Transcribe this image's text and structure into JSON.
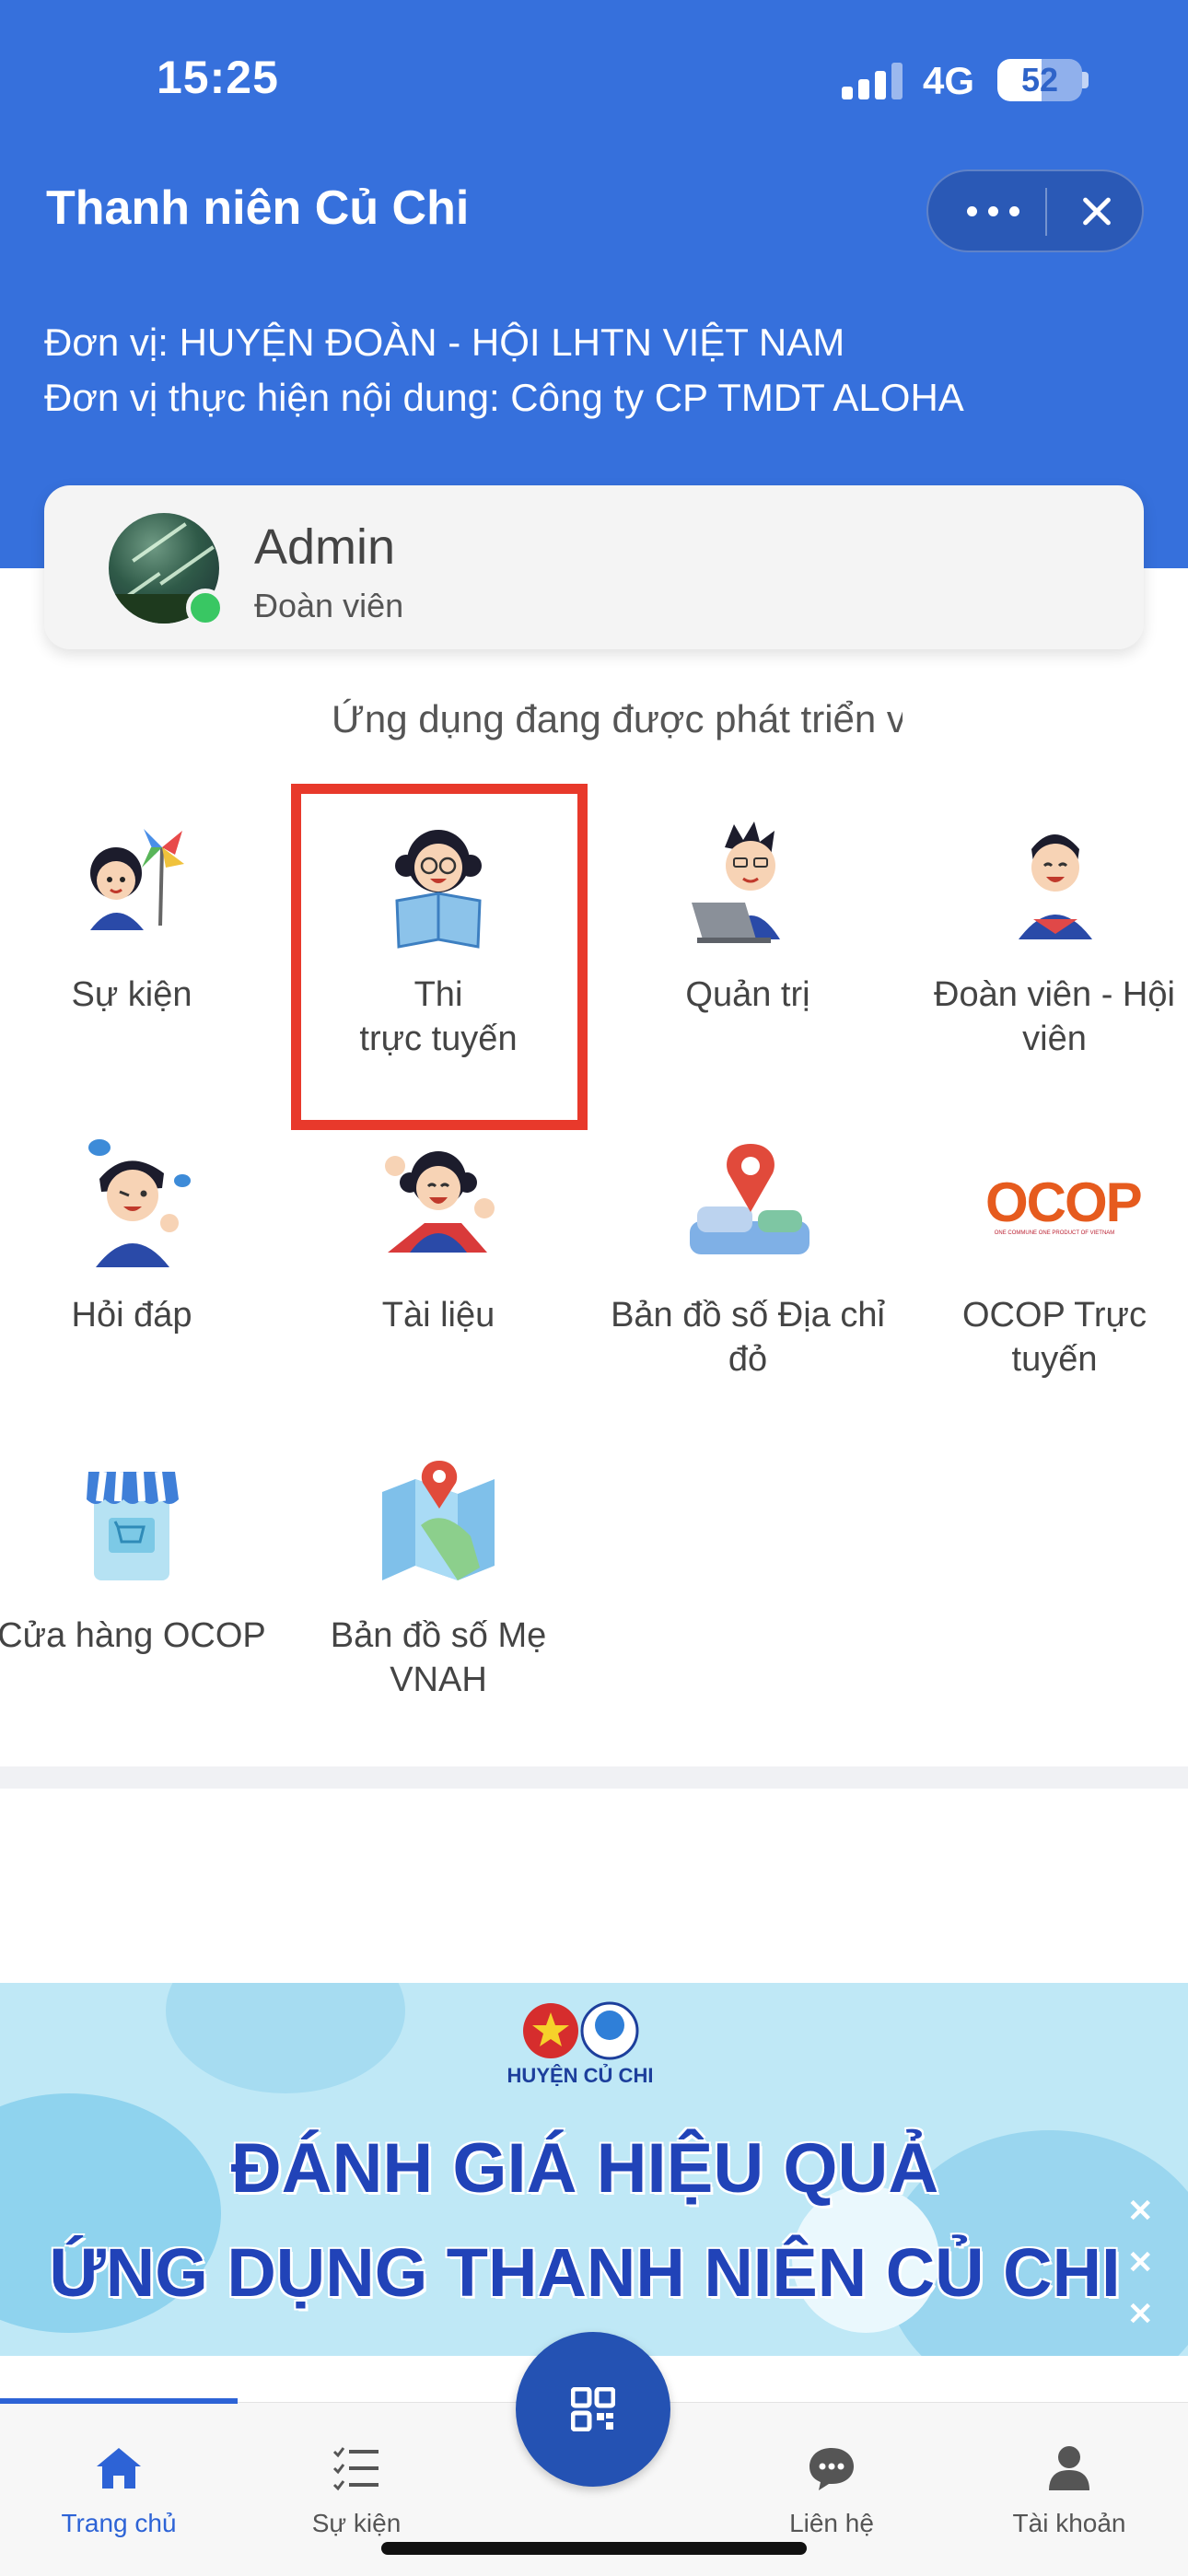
{
  "status_bar": {
    "time": "15:25",
    "network": "4G",
    "battery": "52",
    "battery_level": 0.52
  },
  "header": {
    "title": "Thanh niên Củ Chi",
    "org_line1": "Đơn vị: HUYỆN ĐOÀN - HỘI LHTN VIỆT NAM",
    "org_line2": "Đơn vị thực hiện nội dung: Công ty CP TMDT ALOHA",
    "more_icon": "more-horizontal-icon",
    "close_icon": "close-icon"
  },
  "profile": {
    "name": "Admin",
    "role": "Đoàn viên",
    "online": true
  },
  "marquee": "Ứng dụng đang được phát triển v",
  "apps": [
    {
      "line1": "Sự kiện",
      "line2": "",
      "icon": "pinwheel-girl-icon"
    },
    {
      "line1": "Thi",
      "line2": "trực tuyến",
      "icon": "reading-girl-icon"
    },
    {
      "line1": "Quản trị",
      "line2": "",
      "icon": "laptop-boy-icon"
    },
    {
      "line1": "Đoàn viên - Hội",
      "line2": "viên",
      "icon": "member-boy-icon"
    },
    {
      "line1": "Hỏi đáp",
      "line2": "",
      "icon": "qa-boy-icon"
    },
    {
      "line1": "Tài liệu",
      "line2": "",
      "icon": "cheering-girl-icon"
    },
    {
      "line1": "Bản đồ số Địa chỉ",
      "line2": "đỏ",
      "icon": "map-pin-icon"
    },
    {
      "line1": "OCOP Trực",
      "line2": "tuyến",
      "icon": "ocop-logo-icon"
    },
    {
      "line1": "Cửa hàng OCOP",
      "line2": "",
      "icon": "shop-icon"
    },
    {
      "line1": "Bản đồ số Mẹ",
      "line2": "VNAH",
      "icon": "folded-map-icon"
    }
  ],
  "ocop_logo": {
    "text": "OCOP",
    "subtext": "ONE COMMUNE ONE PRODUCT OF VIETNAM"
  },
  "banner": {
    "logo_text": "HUYỆN CỦ CHI",
    "line1": "ĐÁNH GIÁ HIỆU QUẢ",
    "line2": "ỨNG DỤNG THANH NIÊN CỦ CHI",
    "text_color": "#2143b8"
  },
  "tabs": [
    {
      "label": "Trang chủ",
      "icon": "home-icon",
      "active": true
    },
    {
      "label": "Sự kiện",
      "icon": "checklist-icon",
      "active": false
    },
    {
      "label": "Liên hệ",
      "icon": "chat-bubble-icon",
      "active": false
    },
    {
      "label": "Tài khoản",
      "icon": "person-icon",
      "active": false
    }
  ],
  "fab_icon": "qr-code-icon",
  "colors": {
    "header": "#3670dc",
    "accent": "#2d63d6",
    "highlight": "#e8392b",
    "fab": "#2452b3"
  }
}
